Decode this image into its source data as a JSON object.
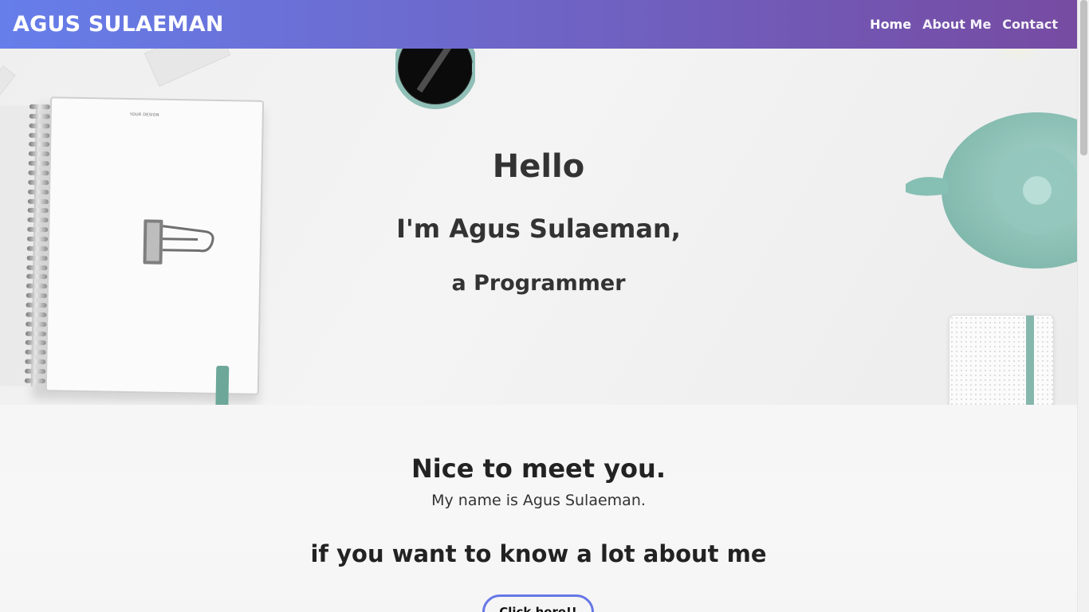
{
  "navbar": {
    "brand": "AGUS SULAEMAN",
    "links": [
      {
        "label": "Home",
        "active": true
      },
      {
        "label": "About Me",
        "active": false
      },
      {
        "label": "Contact",
        "active": false
      }
    ],
    "gradient_from": "#667eea",
    "gradient_to": "#764ba2"
  },
  "hero": {
    "hello": "Hello",
    "name_line": "I'm Agus Sulaeman,",
    "role_line": "a Programmer",
    "notebook_text": "YOUR DESIGN"
  },
  "content": {
    "heading": "Nice to meet you.",
    "subtext": "My name is Agus Sulaeman.",
    "cta_heading": "if you want to know a lot about me",
    "cta_button_label": "Click here!!"
  },
  "colors": {
    "accent": "#667eea",
    "text_dark": "#333333",
    "teal_decor": "#6da79a"
  }
}
